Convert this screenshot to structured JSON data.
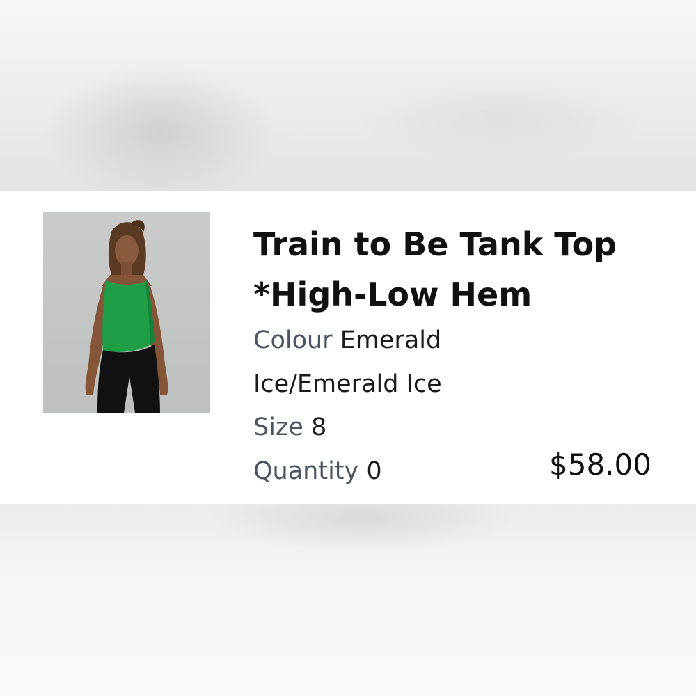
{
  "product": {
    "title_line1": "Train to Be Tank Top",
    "title_line2": "*High-Low Hem",
    "colour_label": "Colour",
    "colour_value_line1": "Emerald",
    "colour_value_line2": "Ice/Emerald Ice",
    "size_label": "Size",
    "size_value": "8",
    "quantity_label": "Quantity",
    "quantity_value": "0",
    "price": "$58.00",
    "image_icon": "product-photo",
    "accent_color": "#1f9e45"
  }
}
